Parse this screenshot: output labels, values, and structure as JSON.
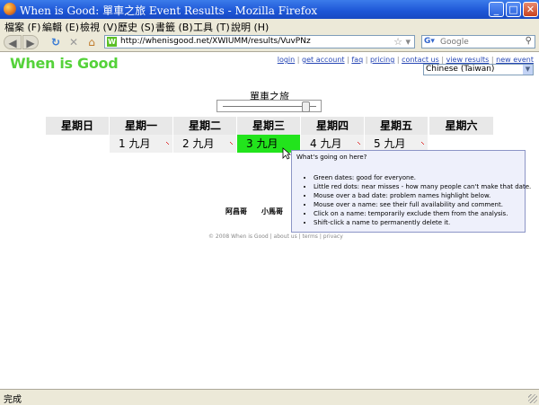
{
  "window": {
    "title": "When is Good: 單車之旅 Event Results - Mozilla Firefox",
    "controls": [
      "_",
      "□",
      "✕"
    ]
  },
  "menu": [
    "檔案 (F)",
    "編輯 (E)",
    "檢視 (V)",
    "歷史 (S)",
    "書籤 (B)",
    "工具 (T)",
    "說明 (H)"
  ],
  "navbar": {
    "url": "http://whenisgood.net/XWIUMM/results/VuvPNz",
    "search_placeholder": "Google",
    "icons": [
      "back-icon",
      "forward-icon",
      "reload-icon",
      "stop-icon",
      "home-icon"
    ]
  },
  "page": {
    "logo": "When is Good",
    "links": [
      "login",
      "get account",
      "faq",
      "pricing",
      "contact us",
      "view results",
      "new event"
    ],
    "language": "Chinese (Taiwan)",
    "event_title": "單車之旅",
    "slider_level": 0.9,
    "days": [
      "星期日",
      "星期一",
      "星期二",
      "星期三",
      "星期四",
      "星期五",
      "星期六"
    ],
    "dates": [
      {
        "label": "1 九月",
        "highlight": false
      },
      {
        "label": "2 九月",
        "highlight": false
      },
      {
        "label": "3 九月",
        "highlight": true
      },
      {
        "label": "4 九月",
        "highlight": false
      },
      {
        "label": "5 九月",
        "highlight": false
      }
    ],
    "names": [
      "阿昌哥",
      "小馬哥"
    ],
    "footer": "© 2008 When is Good | about us | terms | privacy",
    "popup": {
      "title": "What's going on here?",
      "items": [
        "Green dates: good for everyone.",
        "Little red dots: near misses - how many people can't make that date.",
        "Mouse over a bad date: problem names highlight below.",
        "Mouse over a name: see their full availability and comment.",
        "Click on a name: temporarily exclude them from the analysis.",
        "Shift-click a name to permanently delete it."
      ]
    }
  },
  "status": "完成",
  "colors": {
    "titlebar": "#1d56d6",
    "logo": "#55d23a",
    "good_date": "#22e41c",
    "near_miss_dot": "#e03030",
    "popup_bg": "#eef0fb"
  }
}
